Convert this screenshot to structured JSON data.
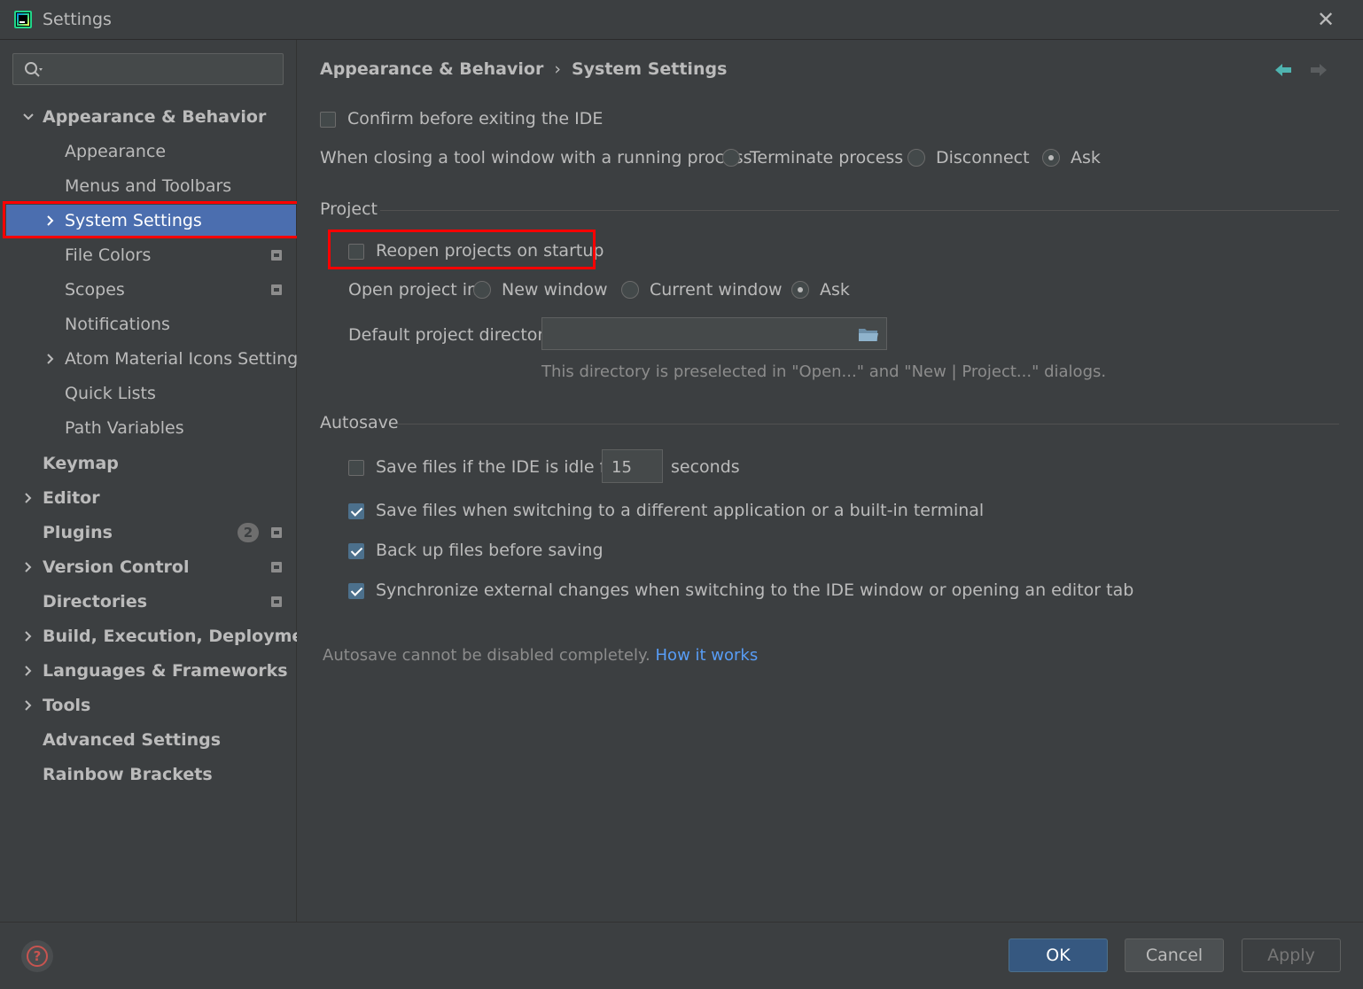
{
  "window": {
    "title": "Settings"
  },
  "search": {
    "placeholder": "",
    "value": ""
  },
  "sidebar": {
    "items": [
      {
        "label": "Appearance & Behavior"
      },
      {
        "label": "Appearance"
      },
      {
        "label": "Menus and Toolbars"
      },
      {
        "label": "System Settings"
      },
      {
        "label": "File Colors"
      },
      {
        "label": "Scopes"
      },
      {
        "label": "Notifications"
      },
      {
        "label": "Atom Material Icons Settings"
      },
      {
        "label": "Quick Lists"
      },
      {
        "label": "Path Variables"
      },
      {
        "label": "Keymap"
      },
      {
        "label": "Editor"
      },
      {
        "label": "Plugins",
        "badge": "2"
      },
      {
        "label": "Version Control"
      },
      {
        "label": "Directories"
      },
      {
        "label": "Build, Execution, Deployment"
      },
      {
        "label": "Languages & Frameworks"
      },
      {
        "label": "Tools"
      },
      {
        "label": "Advanced Settings"
      },
      {
        "label": "Rainbow Brackets"
      }
    ]
  },
  "breadcrumb": {
    "parent": "Appearance & Behavior",
    "separator": "›",
    "current": "System Settings"
  },
  "general": {
    "confirm_exit": "Confirm before exiting the IDE",
    "closing_label": "When closing a tool window with a running process:",
    "closing_options": [
      "Terminate process",
      "Disconnect",
      "Ask"
    ],
    "closing_selected": "Ask"
  },
  "project": {
    "title": "Project",
    "reopen": "Reopen projects on startup",
    "open_in_label": "Open project in",
    "open_in_options": [
      "New window",
      "Current window",
      "Ask"
    ],
    "open_in_selected": "Ask",
    "default_dir_label": "Default project directory:",
    "default_dir_value": "",
    "default_dir_hint": "This directory is preselected in \"Open...\" and \"New | Project...\" dialogs."
  },
  "autosave": {
    "title": "Autosave",
    "idle_label": "Save files if the IDE is idle for",
    "idle_value": "15",
    "idle_unit": "seconds",
    "switch_app": "Save files when switching to a different application or a built-in terminal",
    "backup": "Back up files before saving",
    "sync_external": "Synchronize external changes when switching to the IDE window or opening an editor tab",
    "note": "Autosave cannot be disabled completely.",
    "link": "How it works"
  },
  "footer": {
    "ok": "OK",
    "cancel": "Cancel",
    "apply": "Apply"
  },
  "colors": {
    "accent": "#4b6eaf",
    "background": "#3c3f41",
    "highlight": "#ff0000",
    "link": "#589df6"
  }
}
